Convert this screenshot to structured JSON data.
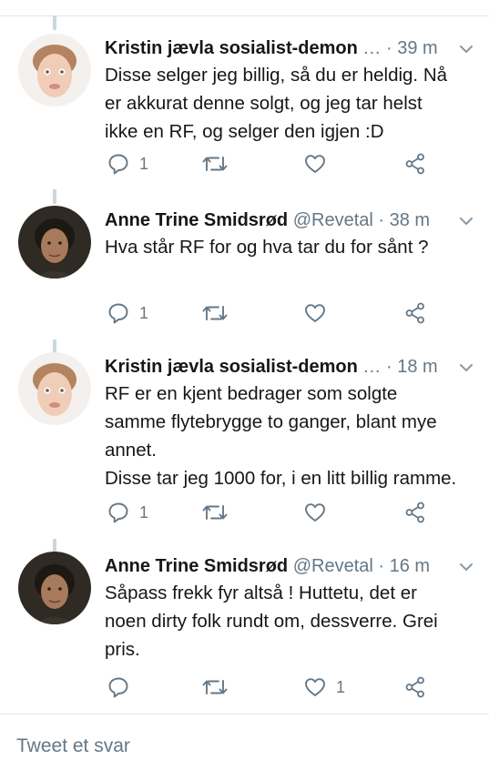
{
  "tweets": [
    {
      "name": "Kristin jævla sosialist-demon",
      "handle": "…",
      "time": "· 39 m",
      "text": "Disse selger jeg billig, så du er heldig. Nå\ner akkurat denne solgt, og jeg tar helst\nikke en RF, og selger den igjen :D",
      "reply_count": "1",
      "retweet_count": "",
      "like_count": ""
    },
    {
      "name": "Anne Trine Smidsrød",
      "handle": "@Revetal",
      "time": "· 38 m",
      "text": "Hva står RF for og hva tar du for sånt ?",
      "reply_count": "1",
      "retweet_count": "",
      "like_count": ""
    },
    {
      "name": "Kristin jævla sosialist-demon",
      "handle": "…",
      "time": "· 18 m",
      "text": "RF er en kjent bedrager som solgte\nsamme flytebrygge to ganger, blant mye\nannet.\nDisse tar jeg 1000 for, i en litt billig ramme.",
      "reply_count": "1",
      "retweet_count": "",
      "like_count": ""
    },
    {
      "name": "Anne Trine Smidsrød",
      "handle": "@Revetal",
      "time": "· 16 m",
      "text": "Såpass frekk fyr altså ! Huttetu, det er\nnoen dirty folk rundt om, dessverre. Grei\npris.",
      "reply_count": "",
      "retweet_count": "",
      "like_count": "1"
    }
  ],
  "icons": {
    "reply": "reply-icon",
    "retweet": "retweet-icon",
    "like": "heart-icon",
    "share": "share-icon",
    "more": "chevron-down-icon"
  },
  "reply_box": {
    "placeholder": "Tweet et svar"
  },
  "colors": {
    "text": "#14171a",
    "muted": "#657786",
    "divider": "#e1e8ed"
  }
}
